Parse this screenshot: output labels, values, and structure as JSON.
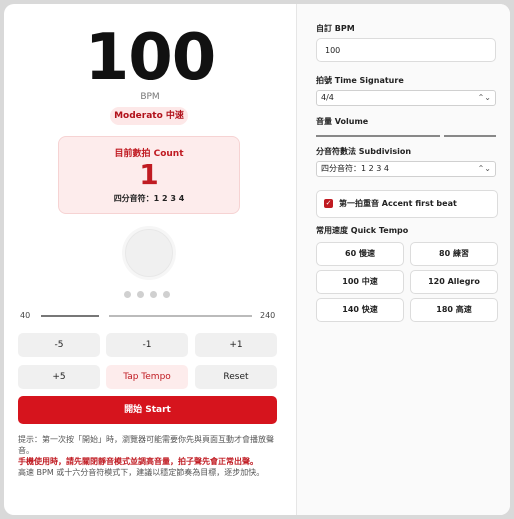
{
  "display": {
    "bpm_value": "100",
    "bpm_unit": "BPM",
    "tempo_name": "Moderato 中速"
  },
  "count": {
    "title": "目前數拍 Count",
    "value": "1",
    "subdivision": "四分音符：1 2 3 4"
  },
  "slider": {
    "min_label": "40",
    "max_label": "240",
    "value_fraction": 0.3
  },
  "buttons": {
    "minus5": "-5",
    "minus1": "-1",
    "plus1": "+1",
    "plus5": "+5",
    "tap": "Tap Tempo",
    "reset": "Reset",
    "start": "開始 Start"
  },
  "tips": {
    "line1": "提示：第一次按「開始」時，瀏覽器可能需要你先與頁面互動才會播放聲音。",
    "warning": "手機使用時，請先關閉靜音模式並調高音量，拍子聲先會正常出聲。",
    "line3": "高速 BPM 或十六分音符模式下，建議以穩定節奏為目標，逐步加快。"
  },
  "settings": {
    "custom_bpm_label": "自訂 BPM",
    "custom_bpm_value": "100",
    "time_sig_label": "拍號 Time Signature",
    "time_sig_value": "4/4",
    "volume_label": "音量 Volume",
    "volume_fraction": 0.8,
    "subdivision_label": "分音符數法 Subdivision",
    "subdivision_value": "四分音符：1 2 3 4",
    "accent_label": "第一拍重音 Accent first beat",
    "accent_checked": true,
    "quick_label": "常用速度 Quick Tempo",
    "quick": [
      "60 慢速",
      "80 練習",
      "100 中速",
      "120 Allegro",
      "140 快速",
      "180 高速"
    ]
  },
  "colors": {
    "accent": "#d6141d",
    "accent_text": "#c01b22",
    "accent_bg": "#fdecec"
  }
}
